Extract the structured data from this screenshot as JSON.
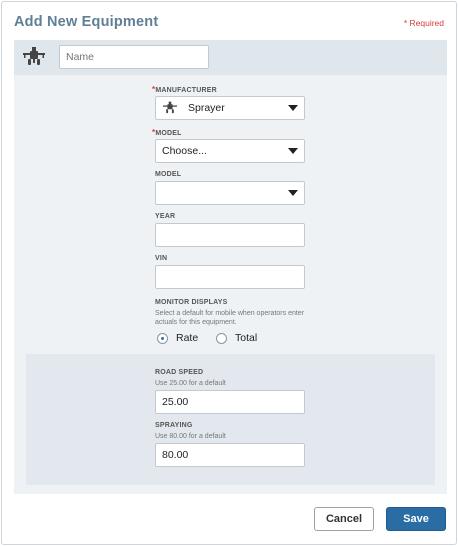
{
  "dialog": {
    "title": "Add New Equipment",
    "required_note": "* Required"
  },
  "header": {
    "name_input": {
      "value": "",
      "placeholder": "Name"
    },
    "icon": "sprayer-icon"
  },
  "form": {
    "manufacturer": {
      "label": "MANUFACTURER",
      "required": true,
      "value": "Sprayer",
      "icon": "sprayer-icon"
    },
    "model_required": {
      "label": "MODEL",
      "required": true,
      "value": "Choose..."
    },
    "model": {
      "label": "MODEL",
      "value": ""
    },
    "year": {
      "label": "YEAR",
      "value": ""
    },
    "vin": {
      "label": "VIN",
      "value": ""
    },
    "monitor_displays": {
      "label": "MONITOR DISPLAYS",
      "hint": "Select a default for mobile when operators enter actuals for this equipment.",
      "options": [
        {
          "label": "Rate",
          "checked": true
        },
        {
          "label": "Total",
          "checked": false
        }
      ]
    },
    "road_speed": {
      "label": "ROAD SPEED",
      "hint": "Use 25.00 for a default",
      "value": "25.00"
    },
    "spraying": {
      "label": "SPRAYING",
      "hint": "Use 80.00 for a default",
      "value": "80.00"
    }
  },
  "actions": {
    "cancel_label": "Cancel",
    "save_label": "Save"
  },
  "colors": {
    "accent": "#2a6ca4",
    "title": "#5f7f95",
    "required": "#d83b3b"
  }
}
